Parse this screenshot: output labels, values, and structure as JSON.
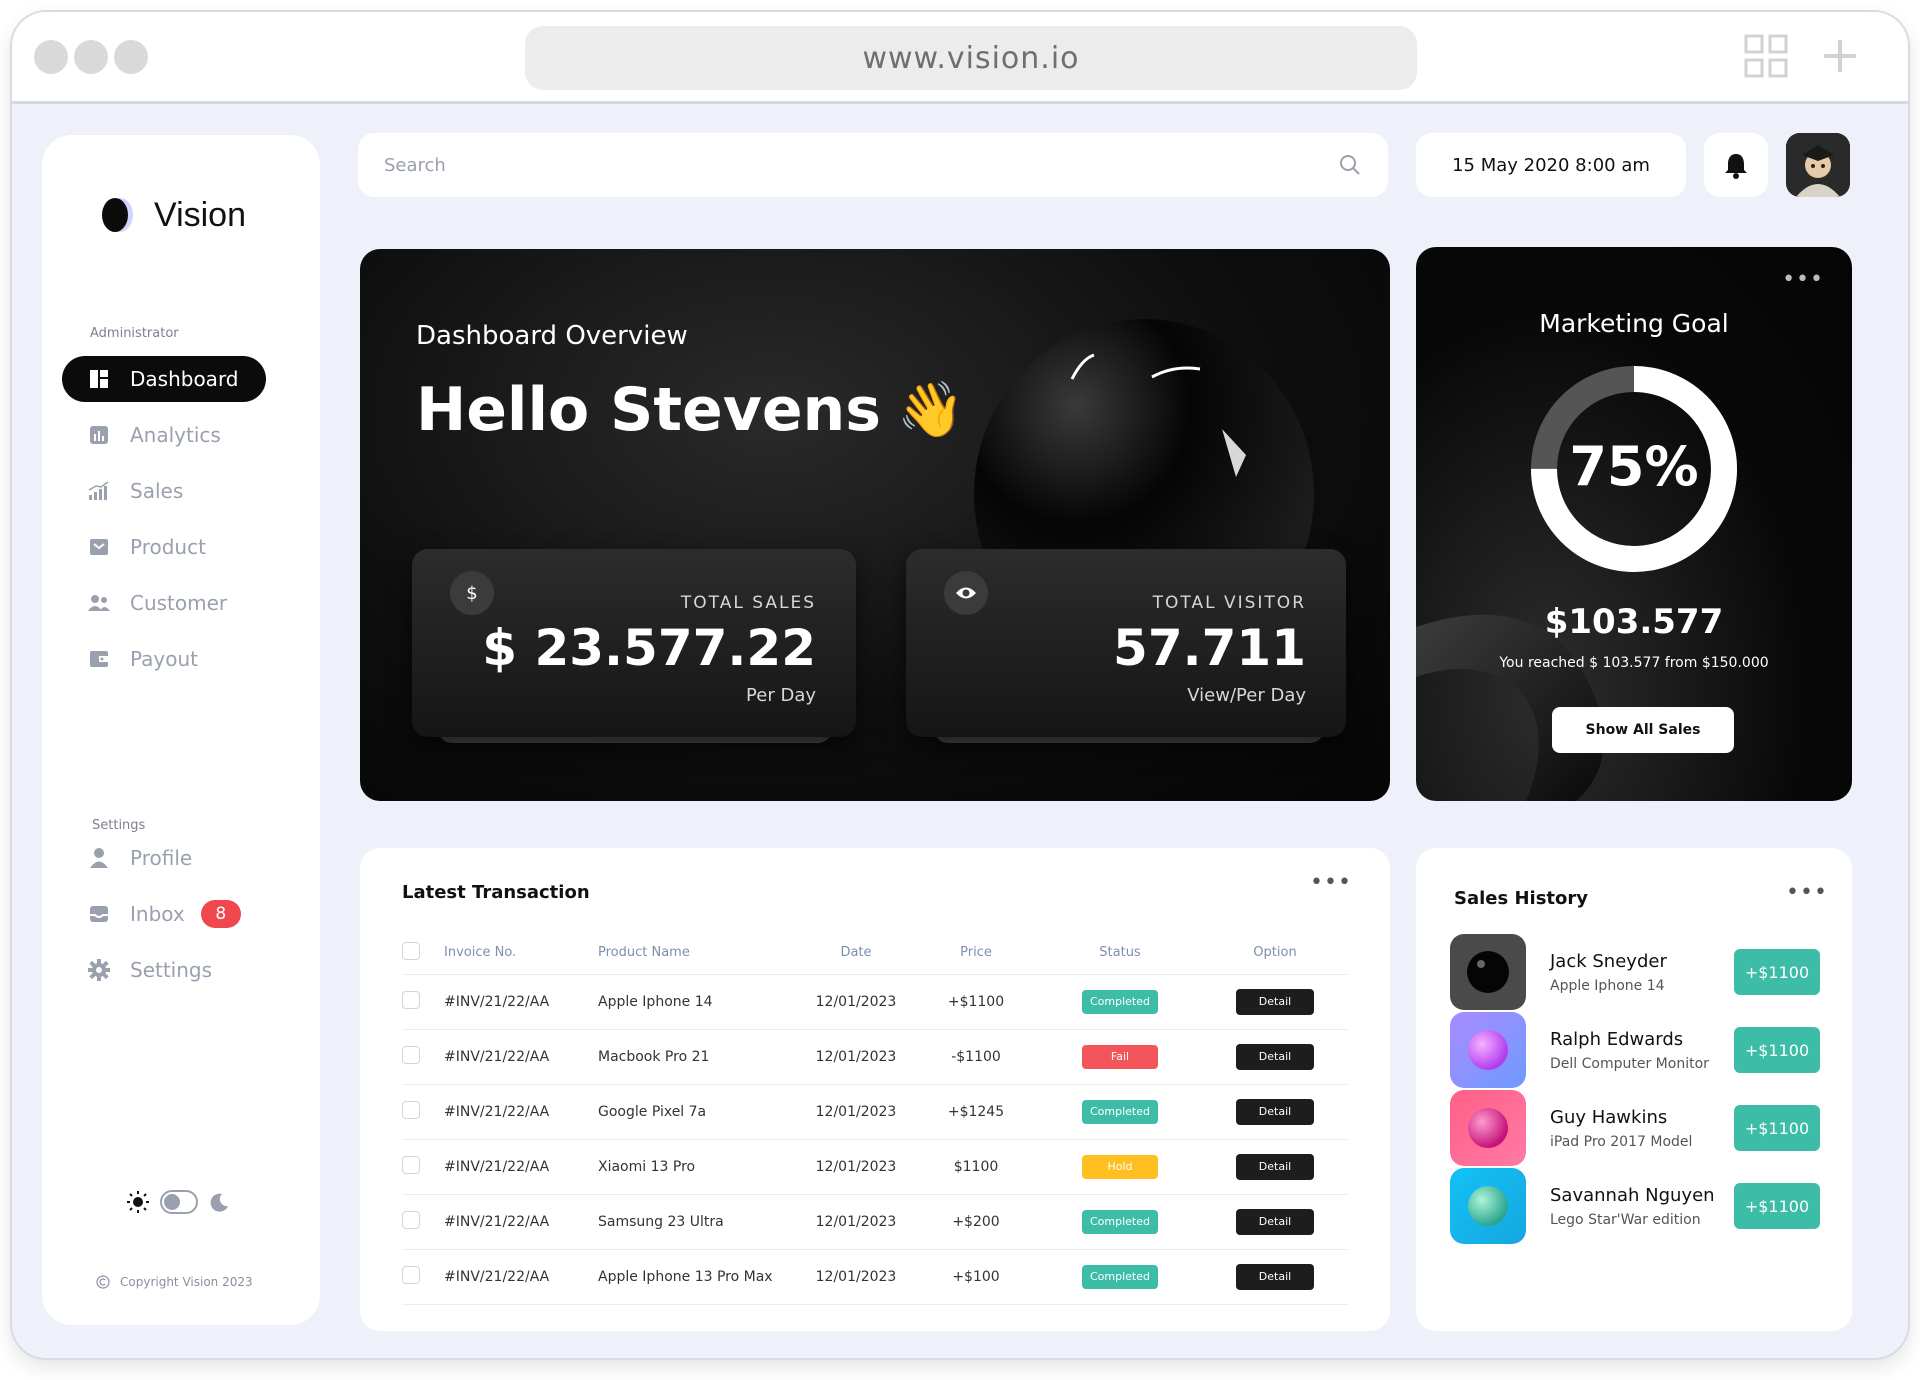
{
  "browser": {
    "url": "www.vision.io"
  },
  "sidebar": {
    "brand": "Vision",
    "admin_label": "Administrator",
    "items": [
      {
        "label": "Dashboard"
      },
      {
        "label": "Analytics"
      },
      {
        "label": "Sales"
      },
      {
        "label": "Product"
      },
      {
        "label": "Customer"
      },
      {
        "label": "Payout"
      }
    ],
    "settings_label": "Settings",
    "settings_items": [
      {
        "label": "Profile"
      },
      {
        "label": "Inbox",
        "badge": "8"
      },
      {
        "label": "Settings"
      }
    ],
    "copyright": "Copyright Vision 2023"
  },
  "topbar": {
    "search_placeholder": "Search",
    "datetime": "15 May 2020 8:00 am"
  },
  "hero": {
    "subtitle": "Dashboard Overview",
    "greeting": "Hello Stevens",
    "emoji": "👋",
    "total_sales": {
      "label": "TOTAL SALES",
      "value": "$ 23.577.22",
      "unit": "Per Day",
      "icon": "$"
    },
    "total_visitor": {
      "label": "TOTAL VISITOR",
      "value": "57.711",
      "unit": "View/Per Day"
    }
  },
  "marketing": {
    "title": "Marketing Goal",
    "percent_label": "75%",
    "percent": 75,
    "amount": "$103.577",
    "description": "You reached $ 103.577 from $150.000",
    "button": "Show All Sales"
  },
  "transactions": {
    "title": "Latest Transaction",
    "columns": [
      "Invoice No.",
      "Product Name",
      "Date",
      "Price",
      "Status",
      "Option"
    ],
    "rows": [
      {
        "invoice": "#INV/21/22/AA",
        "product": "Apple Iphone 14",
        "date": "12/01/2023",
        "price": "+$1100",
        "status": "Completed",
        "option": "Detail"
      },
      {
        "invoice": "#INV/21/22/AA",
        "product": "Macbook Pro 21",
        "date": "12/01/2023",
        "price": "-$1100",
        "status": "Fail",
        "option": "Detail"
      },
      {
        "invoice": "#INV/21/22/AA",
        "product": "Google Pixel 7a",
        "date": "12/01/2023",
        "price": "+$1245",
        "status": "Completed",
        "option": "Detail"
      },
      {
        "invoice": "#INV/21/22/AA",
        "product": "Xiaomi 13 Pro",
        "date": "12/01/2023",
        "price": "$1100",
        "status": "Hold",
        "option": "Detail"
      },
      {
        "invoice": "#INV/21/22/AA",
        "product": "Samsung 23 Ultra",
        "date": "12/01/2023",
        "price": "+$200",
        "status": "Completed",
        "option": "Detail"
      },
      {
        "invoice": "#INV/21/22/AA",
        "product": "Apple Iphone 13 Pro Max",
        "date": "12/01/2023",
        "price": "+$100",
        "status": "Completed",
        "option": "Detail"
      }
    ]
  },
  "sales_history": {
    "title": "Sales History",
    "items": [
      {
        "name": "Jack Sneyder",
        "product": "Apple Iphone 14",
        "amount": "+$1100"
      },
      {
        "name": "Ralph Edwards",
        "product": "Dell Computer Monitor",
        "amount": "+$1100"
      },
      {
        "name": "Guy Hawkins",
        "product": "iPad Pro 2017 Model",
        "amount": "+$1100"
      },
      {
        "name": "Savannah Nguyen",
        "product": "Lego Star'War edition",
        "amount": "+$1100"
      }
    ]
  },
  "colors": {
    "accent_green": "#3dbda8",
    "fail_red": "#f2565b",
    "hold_yellow": "#ffbf21",
    "badge_red": "#f0474e"
  }
}
